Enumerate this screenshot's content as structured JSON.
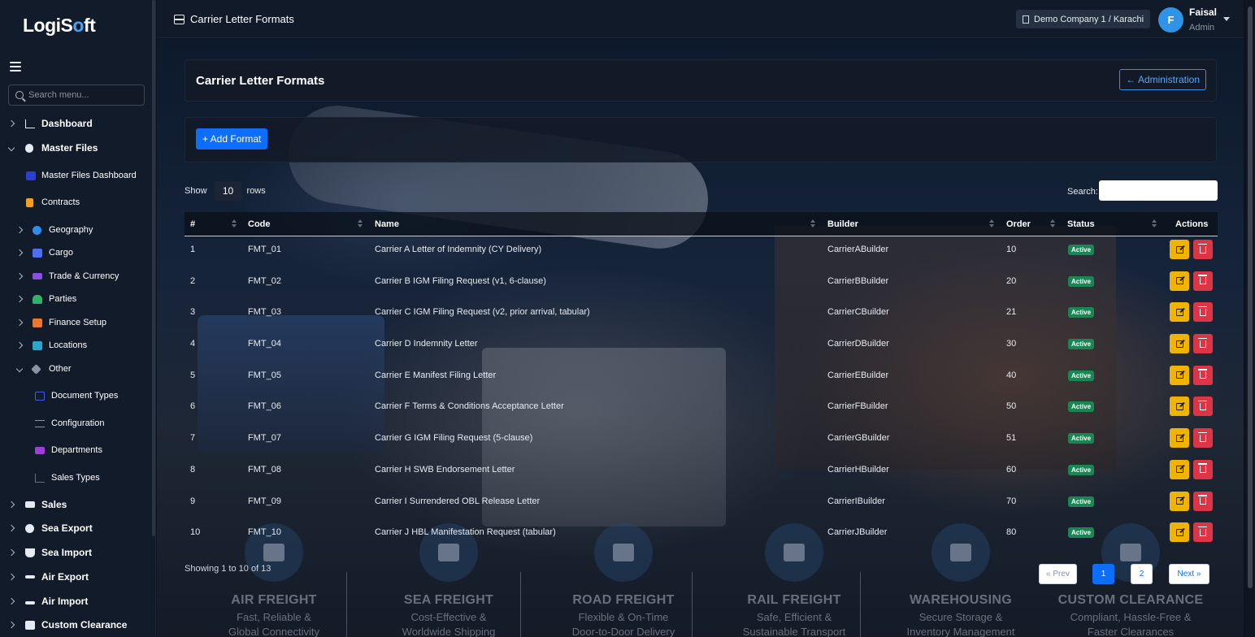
{
  "app": {
    "logo_part1": "Logi",
    "logo_part2": "S",
    "logo_part3": "o",
    "logo_part4": "ft",
    "accent": "#0d6efd"
  },
  "sidebar": {
    "search_placeholder": "Search menu...",
    "items": [
      {
        "label": "Dashboard",
        "level": 1,
        "expanded": false
      },
      {
        "label": "Master Files",
        "level": 1,
        "expanded": true
      },
      {
        "label": "Master Files Dashboard",
        "level": 2
      },
      {
        "label": "Contracts",
        "level": 2
      },
      {
        "label": "Geography",
        "level": 2
      },
      {
        "label": "Cargo",
        "level": 2
      },
      {
        "label": "Trade & Currency",
        "level": 2
      },
      {
        "label": "Parties",
        "level": 2
      },
      {
        "label": "Finance Setup",
        "level": 2
      },
      {
        "label": "Locations",
        "level": 2
      },
      {
        "label": "Other",
        "level": 2,
        "expanded": true
      },
      {
        "label": "Document Types",
        "level": 3
      },
      {
        "label": "Configuration",
        "level": 3
      },
      {
        "label": "Departments",
        "level": 3
      },
      {
        "label": "Sales Types",
        "level": 3
      },
      {
        "label": "Sales",
        "level": 1
      },
      {
        "label": "Sea Export",
        "level": 1
      },
      {
        "label": "Sea Import",
        "level": 1
      },
      {
        "label": "Air Export",
        "level": 1
      },
      {
        "label": "Air Import",
        "level": 1
      },
      {
        "label": "Custom Clearance",
        "level": 1
      }
    ]
  },
  "topbar": {
    "title": "Carrier Letter Formats",
    "company": "Demo Company 1 / Karachi",
    "avatar_letter": "F",
    "user_name": "Faisal",
    "user_role": "Admin"
  },
  "page": {
    "heading": "Carrier Letter Formats",
    "back_button": "← Administration",
    "add_button": "+ Add Format",
    "show_label": "Show",
    "rows_value": "10",
    "rows_label": "rows",
    "search_label": "Search:"
  },
  "table": {
    "columns": [
      "#",
      "Code",
      "Name",
      "Builder",
      "Order",
      "Status",
      "Actions"
    ],
    "rows": [
      {
        "n": "1",
        "code": "FMT_01",
        "name": "Carrier A Letter of Indemnity (CY Delivery)",
        "builder": "CarrierABuilder",
        "order": "10",
        "status": "Active"
      },
      {
        "n": "2",
        "code": "FMT_02",
        "name": "Carrier B IGM Filing Request (v1, 6-clause)",
        "builder": "CarrierBBuilder",
        "order": "20",
        "status": "Active"
      },
      {
        "n": "3",
        "code": "FMT_03",
        "name": "Carrier C IGM Filing Request (v2, prior arrival, tabular)",
        "builder": "CarrierCBuilder",
        "order": "21",
        "status": "Active"
      },
      {
        "n": "4",
        "code": "FMT_04",
        "name": "Carrier D Indemnity Letter",
        "builder": "CarrierDBuilder",
        "order": "30",
        "status": "Active"
      },
      {
        "n": "5",
        "code": "FMT_05",
        "name": "Carrier E Manifest Filing Letter",
        "builder": "CarrierEBuilder",
        "order": "40",
        "status": "Active"
      },
      {
        "n": "6",
        "code": "FMT_06",
        "name": "Carrier F Terms & Conditions Acceptance Letter",
        "builder": "CarrierFBuilder",
        "order": "50",
        "status": "Active"
      },
      {
        "n": "7",
        "code": "FMT_07",
        "name": "Carrier G IGM Filing Request (5-clause)",
        "builder": "CarrierGBuilder",
        "order": "51",
        "status": "Active"
      },
      {
        "n": "8",
        "code": "FMT_08",
        "name": "Carrier H SWB Endorsement Letter",
        "builder": "CarrierHBuilder",
        "order": "60",
        "status": "Active"
      },
      {
        "n": "9",
        "code": "FMT_09",
        "name": "Carrier I Surrendered OBL Release Letter",
        "builder": "CarrierIBuilder",
        "order": "70",
        "status": "Active"
      },
      {
        "n": "10",
        "code": "FMT_10",
        "name": "Carrier J HBL Manifestation Request (tabular)",
        "builder": "CarrierJBuilder",
        "order": "80",
        "status": "Active"
      }
    ],
    "info": "Showing 1 to 10 of 13"
  },
  "pagination": {
    "prev": "« Prev",
    "pages": [
      "1",
      "2"
    ],
    "current": "1",
    "next": "Next »"
  },
  "services": [
    {
      "title": "AIR FREIGHT",
      "line1": "Fast, Reliable &",
      "line2": "Global Connectivity",
      "icon": "plane-icon"
    },
    {
      "title": "SEA FREIGHT",
      "line1": "Cost-Effective &",
      "line2": "Worldwide Shipping",
      "icon": "ship-icon"
    },
    {
      "title": "ROAD FREIGHT",
      "line1": "Flexible & On-Time",
      "line2": "Door-to-Door Delivery",
      "icon": "truck-icon"
    },
    {
      "title": "RAIL FREIGHT",
      "line1": "Safe, Efficient &",
      "line2": "Sustainable Transport",
      "icon": "train-icon"
    },
    {
      "title": "WAREHOUSING",
      "line1": "Secure Storage &",
      "line2": "Inventory Management",
      "icon": "warehouse-icon"
    },
    {
      "title": "CUSTOM CLEARANCE",
      "line1": "Compliant, Hassle-Free &",
      "line2": "Faster Clearances",
      "icon": "clipboard-icon"
    }
  ]
}
